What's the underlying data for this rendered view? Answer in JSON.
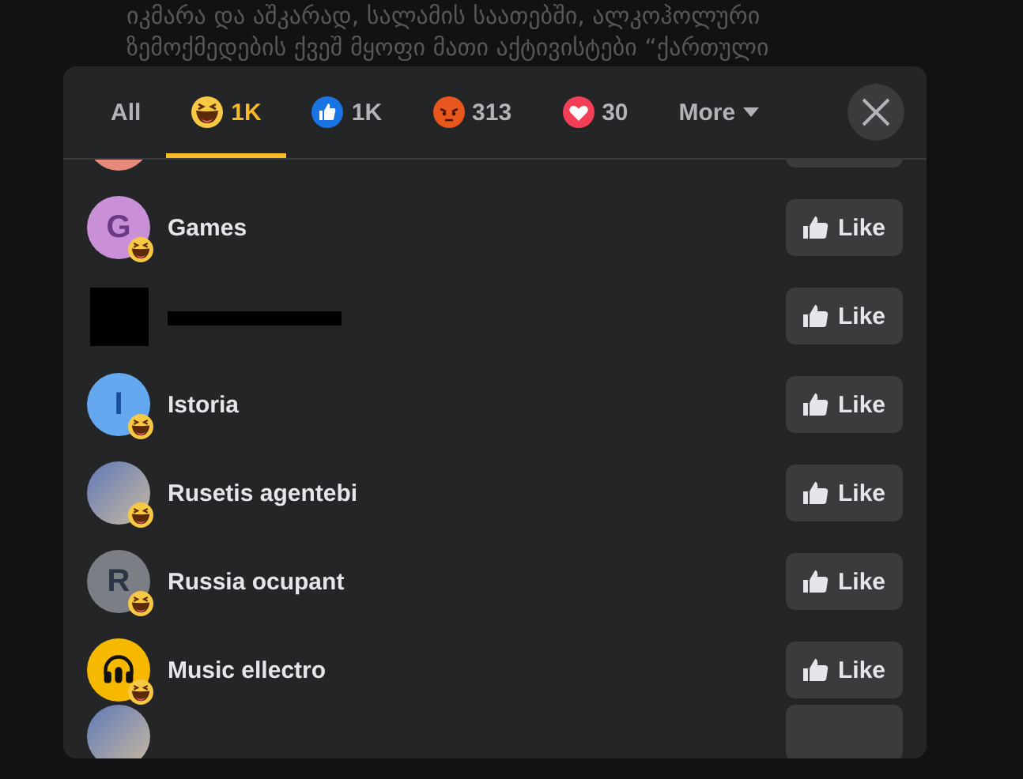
{
  "background_text": [
    "იკმარა და აშკარად, სალამის საათებში, ალკოჰოლური",
    "ზემოქმედების ქვეშ მყოფი მათი აქტივისტები “ქართული"
  ],
  "tabs": [
    {
      "kind": "all",
      "label": "All",
      "selected": false
    },
    {
      "kind": "haha",
      "label": "1K",
      "selected": true
    },
    {
      "kind": "like",
      "label": "1K",
      "selected": false
    },
    {
      "kind": "angry",
      "label": "313",
      "selected": false
    },
    {
      "kind": "love",
      "label": "30",
      "selected": false
    },
    {
      "kind": "more",
      "label": "More",
      "selected": false
    }
  ],
  "people": [
    {
      "name": "Games",
      "avatar": {
        "kind": "letter",
        "letter": "G",
        "color": "#c990d8"
      },
      "button": "Like"
    },
    {
      "avatar": {
        "kind": "redacted"
      },
      "button": "Like"
    },
    {
      "name": "Istoria",
      "avatar": {
        "kind": "letter",
        "letter": "I",
        "color": "#64a8f0"
      },
      "button": "Like"
    },
    {
      "name": "Rusetis agentebi",
      "avatar": {
        "kind": "photo"
      },
      "button": "Like"
    },
    {
      "name": "Russia ocupant",
      "avatar": {
        "kind": "letter",
        "letter": "R",
        "color": "#7b7e84"
      },
      "button": "Like"
    },
    {
      "name": "Music ellectro",
      "avatar": {
        "kind": "headphones",
        "color": "#f7b800"
      },
      "button": "Like"
    }
  ]
}
